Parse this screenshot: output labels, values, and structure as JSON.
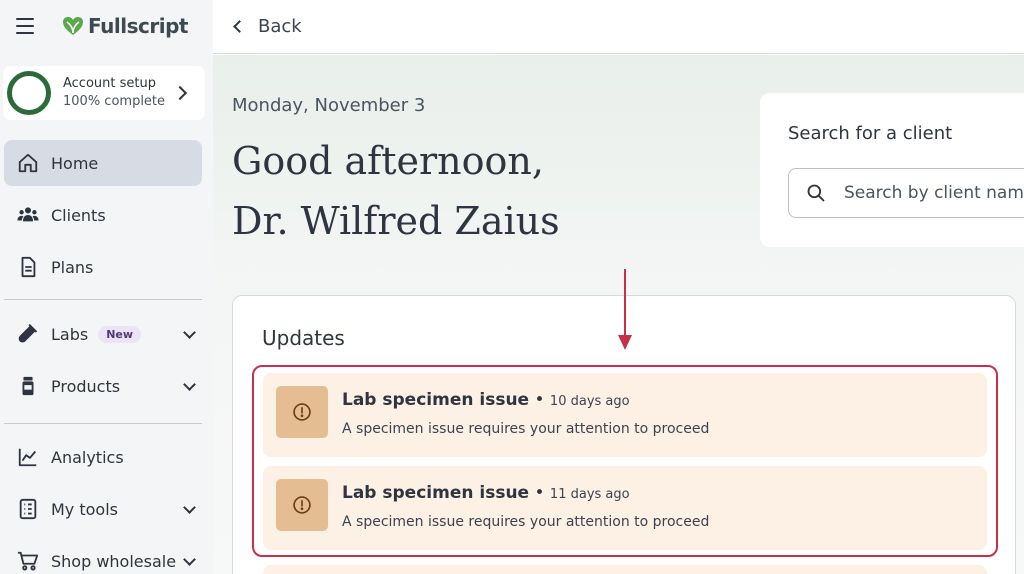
{
  "app": {
    "name": "Fullscript"
  },
  "account": {
    "title": "Account setup",
    "subtitle": "100% complete"
  },
  "sidebar": {
    "items": [
      {
        "label": "Home",
        "icon": "home-icon"
      },
      {
        "label": "Clients",
        "icon": "people-icon"
      },
      {
        "label": "Plans",
        "icon": "document-icon"
      },
      {
        "label": "Labs",
        "icon": "test-tube-icon",
        "badge": "New"
      },
      {
        "label": "Products",
        "icon": "bottle-icon"
      },
      {
        "label": "Analytics",
        "icon": "chart-line-icon"
      },
      {
        "label": "My tools",
        "icon": "checklist-icon"
      },
      {
        "label": "Shop wholesale",
        "icon": "cart-icon"
      }
    ]
  },
  "topbar": {
    "back_label": "Back"
  },
  "main": {
    "date": "Monday, November 3",
    "greeting_line1": "Good afternoon,",
    "greeting_line2": "Dr. Wilfred Zaius"
  },
  "search": {
    "title": "Search for a client",
    "placeholder": "Search by client name"
  },
  "updates": {
    "title": "Updates",
    "items": [
      {
        "title": "Lab specimen issue",
        "time": "10 days ago",
        "description": "A specimen issue requires your attention to proceed"
      },
      {
        "title": "Lab specimen issue",
        "time": "11 days ago",
        "description": "A specimen issue requires your attention to proceed"
      }
    ]
  },
  "colors": {
    "brand": "#2d6a3a",
    "highlight": "#c8304a",
    "update_bg": "#fcf1e4",
    "update_icon_bg": "#e5bd93",
    "active_nav": "#d6dbe4"
  }
}
